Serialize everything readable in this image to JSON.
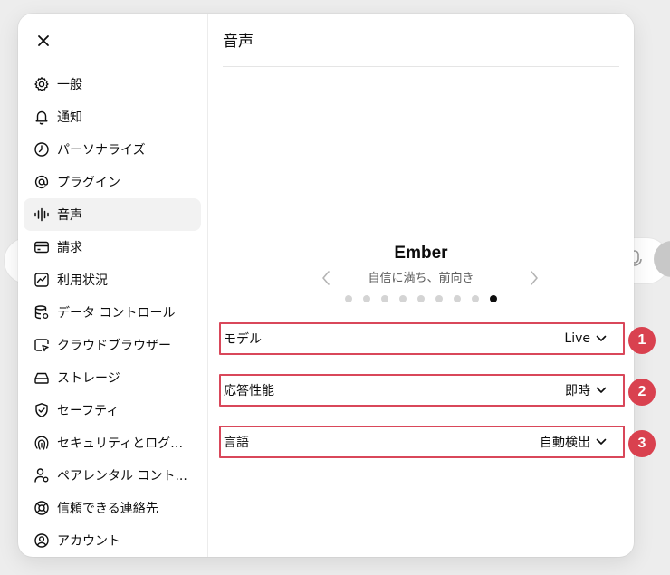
{
  "sidebar": {
    "items": [
      {
        "label": "一般",
        "icon": "gear-icon"
      },
      {
        "label": "通知",
        "icon": "bell-icon"
      },
      {
        "label": "パーソナライズ",
        "icon": "personalize-icon"
      },
      {
        "label": "プラグイン",
        "icon": "at-icon"
      },
      {
        "label": "音声",
        "icon": "waveform-icon",
        "active": true
      },
      {
        "label": "請求",
        "icon": "credit-card-icon"
      },
      {
        "label": "利用状況",
        "icon": "chart-icon"
      },
      {
        "label": "データ コントロール",
        "icon": "database-icon"
      },
      {
        "label": "クラウドブラウザー",
        "icon": "cloud-browser-icon"
      },
      {
        "label": "ストレージ",
        "icon": "storage-icon"
      },
      {
        "label": "セーフティ",
        "icon": "shield-icon"
      },
      {
        "label": "セキュリティとログイ...",
        "icon": "fingerprint-icon"
      },
      {
        "label": "ペアレンタル コント...",
        "icon": "parental-icon"
      },
      {
        "label": "信頼できる連絡先",
        "icon": "lifebuoy-icon"
      },
      {
        "label": "アカウント",
        "icon": "account-icon"
      }
    ]
  },
  "main": {
    "title": "音声",
    "voice": {
      "name": "Ember",
      "description": "自信に満ち、前向き",
      "dot_count": 9,
      "active_index": 8
    },
    "settings": [
      {
        "label": "モデル",
        "value": "Live",
        "badge": "1"
      },
      {
        "label": "応答性能",
        "value": "即時",
        "badge": "2"
      },
      {
        "label": "言語",
        "value": "自動検出",
        "badge": "3"
      }
    ]
  },
  "colors": {
    "highlight": "#d9475a",
    "badge": "#d9414f",
    "active_bg": "#f2f2f2"
  }
}
